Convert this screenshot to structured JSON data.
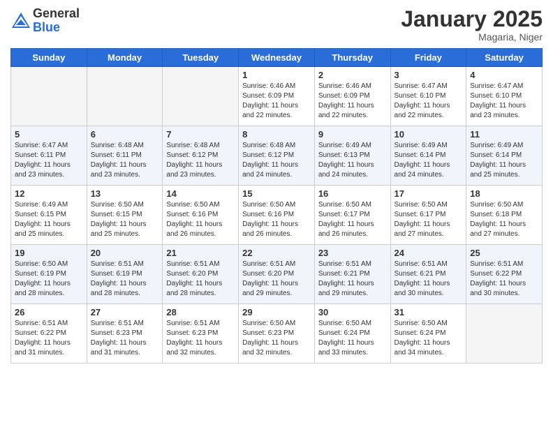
{
  "header": {
    "logo_general": "General",
    "logo_blue": "Blue",
    "month_title": "January 2025",
    "location": "Magaria, Niger"
  },
  "days_of_week": [
    "Sunday",
    "Monday",
    "Tuesday",
    "Wednesday",
    "Thursday",
    "Friday",
    "Saturday"
  ],
  "weeks": [
    {
      "alt": false,
      "days": [
        {
          "num": "",
          "info": ""
        },
        {
          "num": "",
          "info": ""
        },
        {
          "num": "",
          "info": ""
        },
        {
          "num": "1",
          "info": "Sunrise: 6:46 AM\nSunset: 6:09 PM\nDaylight: 11 hours\nand 22 minutes."
        },
        {
          "num": "2",
          "info": "Sunrise: 6:46 AM\nSunset: 6:09 PM\nDaylight: 11 hours\nand 22 minutes."
        },
        {
          "num": "3",
          "info": "Sunrise: 6:47 AM\nSunset: 6:10 PM\nDaylight: 11 hours\nand 22 minutes."
        },
        {
          "num": "4",
          "info": "Sunrise: 6:47 AM\nSunset: 6:10 PM\nDaylight: 11 hours\nand 23 minutes."
        }
      ]
    },
    {
      "alt": true,
      "days": [
        {
          "num": "5",
          "info": "Sunrise: 6:47 AM\nSunset: 6:11 PM\nDaylight: 11 hours\nand 23 minutes."
        },
        {
          "num": "6",
          "info": "Sunrise: 6:48 AM\nSunset: 6:11 PM\nDaylight: 11 hours\nand 23 minutes."
        },
        {
          "num": "7",
          "info": "Sunrise: 6:48 AM\nSunset: 6:12 PM\nDaylight: 11 hours\nand 23 minutes."
        },
        {
          "num": "8",
          "info": "Sunrise: 6:48 AM\nSunset: 6:12 PM\nDaylight: 11 hours\nand 24 minutes."
        },
        {
          "num": "9",
          "info": "Sunrise: 6:49 AM\nSunset: 6:13 PM\nDaylight: 11 hours\nand 24 minutes."
        },
        {
          "num": "10",
          "info": "Sunrise: 6:49 AM\nSunset: 6:14 PM\nDaylight: 11 hours\nand 24 minutes."
        },
        {
          "num": "11",
          "info": "Sunrise: 6:49 AM\nSunset: 6:14 PM\nDaylight: 11 hours\nand 25 minutes."
        }
      ]
    },
    {
      "alt": false,
      "days": [
        {
          "num": "12",
          "info": "Sunrise: 6:49 AM\nSunset: 6:15 PM\nDaylight: 11 hours\nand 25 minutes."
        },
        {
          "num": "13",
          "info": "Sunrise: 6:50 AM\nSunset: 6:15 PM\nDaylight: 11 hours\nand 25 minutes."
        },
        {
          "num": "14",
          "info": "Sunrise: 6:50 AM\nSunset: 6:16 PM\nDaylight: 11 hours\nand 26 minutes."
        },
        {
          "num": "15",
          "info": "Sunrise: 6:50 AM\nSunset: 6:16 PM\nDaylight: 11 hours\nand 26 minutes."
        },
        {
          "num": "16",
          "info": "Sunrise: 6:50 AM\nSunset: 6:17 PM\nDaylight: 11 hours\nand 26 minutes."
        },
        {
          "num": "17",
          "info": "Sunrise: 6:50 AM\nSunset: 6:17 PM\nDaylight: 11 hours\nand 27 minutes."
        },
        {
          "num": "18",
          "info": "Sunrise: 6:50 AM\nSunset: 6:18 PM\nDaylight: 11 hours\nand 27 minutes."
        }
      ]
    },
    {
      "alt": true,
      "days": [
        {
          "num": "19",
          "info": "Sunrise: 6:50 AM\nSunset: 6:19 PM\nDaylight: 11 hours\nand 28 minutes."
        },
        {
          "num": "20",
          "info": "Sunrise: 6:51 AM\nSunset: 6:19 PM\nDaylight: 11 hours\nand 28 minutes."
        },
        {
          "num": "21",
          "info": "Sunrise: 6:51 AM\nSunset: 6:20 PM\nDaylight: 11 hours\nand 28 minutes."
        },
        {
          "num": "22",
          "info": "Sunrise: 6:51 AM\nSunset: 6:20 PM\nDaylight: 11 hours\nand 29 minutes."
        },
        {
          "num": "23",
          "info": "Sunrise: 6:51 AM\nSunset: 6:21 PM\nDaylight: 11 hours\nand 29 minutes."
        },
        {
          "num": "24",
          "info": "Sunrise: 6:51 AM\nSunset: 6:21 PM\nDaylight: 11 hours\nand 30 minutes."
        },
        {
          "num": "25",
          "info": "Sunrise: 6:51 AM\nSunset: 6:22 PM\nDaylight: 11 hours\nand 30 minutes."
        }
      ]
    },
    {
      "alt": false,
      "days": [
        {
          "num": "26",
          "info": "Sunrise: 6:51 AM\nSunset: 6:22 PM\nDaylight: 11 hours\nand 31 minutes."
        },
        {
          "num": "27",
          "info": "Sunrise: 6:51 AM\nSunset: 6:23 PM\nDaylight: 11 hours\nand 31 minutes."
        },
        {
          "num": "28",
          "info": "Sunrise: 6:51 AM\nSunset: 6:23 PM\nDaylight: 11 hours\nand 32 minutes."
        },
        {
          "num": "29",
          "info": "Sunrise: 6:50 AM\nSunset: 6:23 PM\nDaylight: 11 hours\nand 32 minutes."
        },
        {
          "num": "30",
          "info": "Sunrise: 6:50 AM\nSunset: 6:24 PM\nDaylight: 11 hours\nand 33 minutes."
        },
        {
          "num": "31",
          "info": "Sunrise: 6:50 AM\nSunset: 6:24 PM\nDaylight: 11 hours\nand 34 minutes."
        },
        {
          "num": "",
          "info": ""
        }
      ]
    }
  ]
}
